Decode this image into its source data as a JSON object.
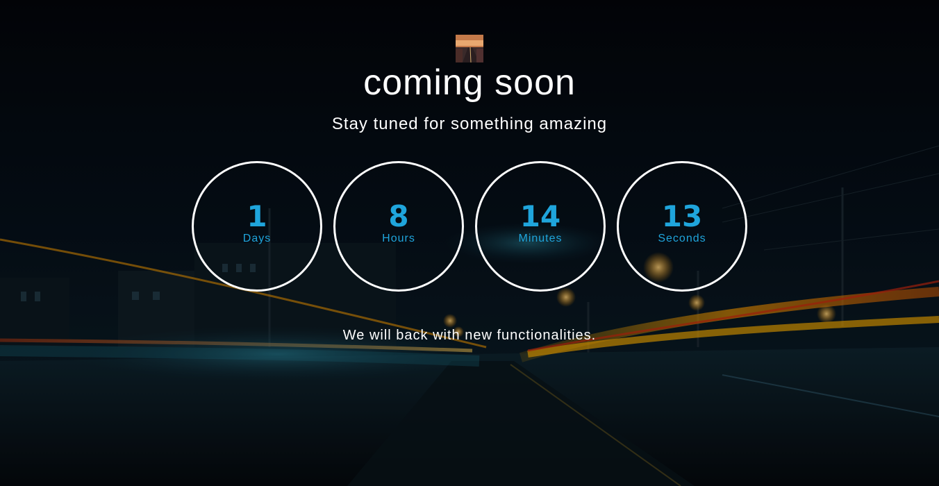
{
  "header": {
    "logo_icon": "road-thumbnail-icon",
    "title": "coming soon",
    "subtitle": "Stay tuned for something amazing"
  },
  "countdown": [
    {
      "value": "1",
      "label": "Days"
    },
    {
      "value": "8",
      "label": "Hours"
    },
    {
      "value": "14",
      "label": "Minutes"
    },
    {
      "value": "13",
      "label": "Seconds"
    }
  ],
  "footer": {
    "message": "We will back with new functionalities."
  },
  "colors": {
    "accent": "#1fa5dc",
    "text": "#ffffff",
    "background": "#04060c"
  }
}
